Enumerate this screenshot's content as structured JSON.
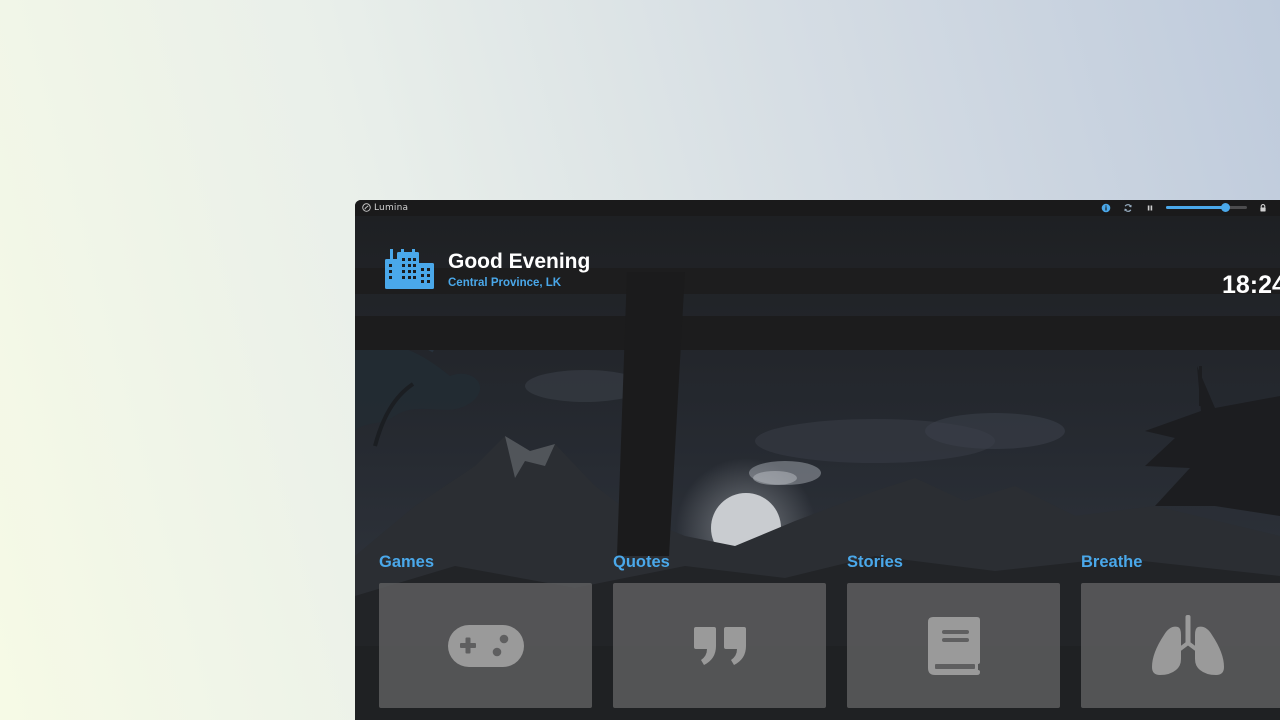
{
  "app": {
    "name": "Lumina"
  },
  "titlebar": {
    "icons": [
      "info-icon",
      "refresh-icon",
      "pause-icon",
      "lock-icon"
    ],
    "volume_level": 0.73
  },
  "header": {
    "greeting": "Good Evening",
    "location": "Central Province, LK",
    "time": "18:24",
    "weather_icon": "city-buildings-icon"
  },
  "categories": [
    {
      "label": "Games",
      "icon": "gamepad-icon"
    },
    {
      "label": "Quotes",
      "icon": "quote-icon"
    },
    {
      "label": "Stories",
      "icon": "book-icon"
    },
    {
      "label": "Breathe",
      "icon": "lungs-icon"
    }
  ],
  "colors": {
    "accent": "#4aa8ea",
    "window_bg": "#1c1c1d",
    "card_bg": "#5f5f60",
    "icon_fill": "#9a9a9a"
  }
}
